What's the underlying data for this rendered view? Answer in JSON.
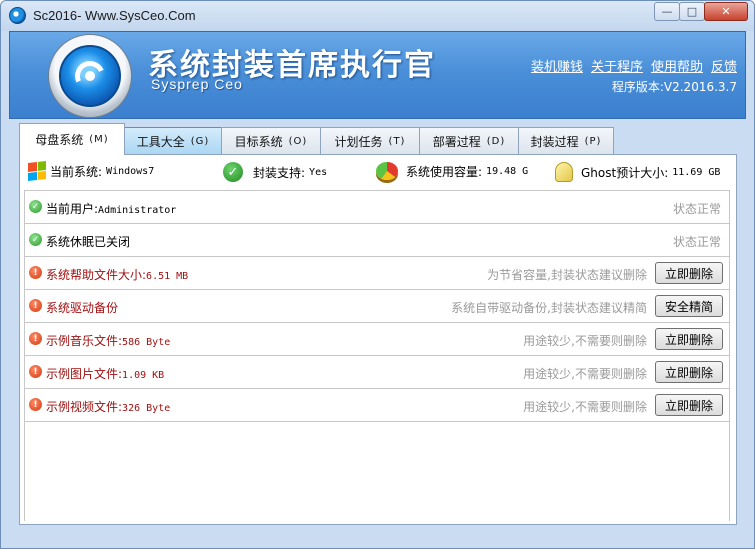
{
  "window": {
    "title": "Sc2016- Www.SysCeo.Com"
  },
  "header": {
    "brand_cn": "系统封装首席执行官",
    "brand_en": "Sysprep Ceo",
    "links": [
      "装机赚钱",
      "关于程序",
      "使用帮助",
      "反馈"
    ],
    "version": "程序版本:V2.2016.3.7"
  },
  "tabs": [
    {
      "label": "母盘系统",
      "accel": "(M)",
      "state": "active"
    },
    {
      "label": "工具大全",
      "accel": "(G)",
      "state": "hover"
    },
    {
      "label": "目标系统",
      "accel": "(O)",
      "state": "normal"
    },
    {
      "label": "计划任务",
      "accel": "(T)",
      "state": "normal"
    },
    {
      "label": "部署过程",
      "accel": "(D)",
      "state": "normal"
    },
    {
      "label": "封装过程",
      "accel": "(P)",
      "state": "normal"
    }
  ],
  "sys_info": {
    "current_system_label": "当前系统:",
    "current_system_value": "Windows7",
    "sysprep_support_label": "封装支持:",
    "sysprep_support_value": "Yes",
    "used_capacity_label": "系统使用容量:",
    "used_capacity_value": "19.48 G",
    "ghost_size_label": "Ghost预计大小:",
    "ghost_size_value": "11.69 GB"
  },
  "rows": [
    {
      "status_icon": "ok",
      "label": "当前用户:",
      "value": "Administrator",
      "hint": "",
      "status_text": "状态正常",
      "button": ""
    },
    {
      "status_icon": "ok",
      "label": "系统休眠已关闭",
      "value": "",
      "hint": "",
      "status_text": "状态正常",
      "button": ""
    },
    {
      "status_icon": "warn",
      "label": "系统帮助文件大小:",
      "value": "6.51 MB",
      "hint": "为节省容量,封装状态建议删除",
      "status_text": "",
      "button": "立即删除"
    },
    {
      "status_icon": "warn",
      "label": "系统驱动备份",
      "value": "",
      "hint": "系统自带驱动备份,封装状态建议精简",
      "status_text": "",
      "button": "安全精简"
    },
    {
      "status_icon": "warn",
      "label": "示例音乐文件:",
      "value": "586 Byte",
      "hint": "用途较少,不需要则删除",
      "status_text": "",
      "button": "立即删除"
    },
    {
      "status_icon": "warn",
      "label": "示例图片文件:",
      "value": "1.09 KB",
      "hint": "用途较少,不需要则删除",
      "status_text": "",
      "button": "立即删除"
    },
    {
      "status_icon": "warn",
      "label": "示例视频文件:",
      "value": "326 Byte",
      "hint": "用途较少,不需要则删除",
      "status_text": "",
      "button": "立即删除"
    }
  ],
  "colors": {
    "header_blue": "#4a8fd8",
    "warn_text": "#a01010",
    "hint_gray": "#9a9a9a"
  }
}
